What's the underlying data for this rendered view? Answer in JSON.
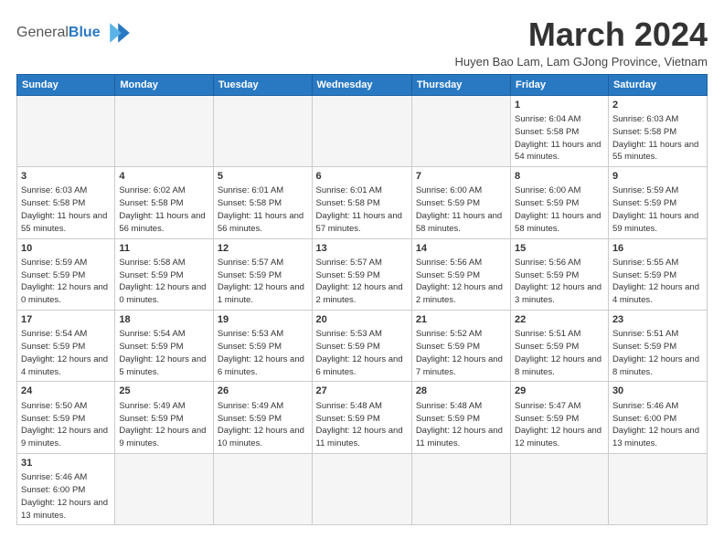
{
  "header": {
    "logo_general": "General",
    "logo_blue": "Blue",
    "month_title": "March 2024",
    "subtitle": "Huyen Bao Lam, Lam GJong Province, Vietnam"
  },
  "weekdays": [
    "Sunday",
    "Monday",
    "Tuesday",
    "Wednesday",
    "Thursday",
    "Friday",
    "Saturday"
  ],
  "weeks": [
    [
      {
        "day": "",
        "info": ""
      },
      {
        "day": "",
        "info": ""
      },
      {
        "day": "",
        "info": ""
      },
      {
        "day": "",
        "info": ""
      },
      {
        "day": "",
        "info": ""
      },
      {
        "day": "1",
        "info": "Sunrise: 6:04 AM\nSunset: 5:58 PM\nDaylight: 11 hours\nand 54 minutes."
      },
      {
        "day": "2",
        "info": "Sunrise: 6:03 AM\nSunset: 5:58 PM\nDaylight: 11 hours\nand 55 minutes."
      }
    ],
    [
      {
        "day": "3",
        "info": "Sunrise: 6:03 AM\nSunset: 5:58 PM\nDaylight: 11 hours\nand 55 minutes."
      },
      {
        "day": "4",
        "info": "Sunrise: 6:02 AM\nSunset: 5:58 PM\nDaylight: 11 hours\nand 56 minutes."
      },
      {
        "day": "5",
        "info": "Sunrise: 6:01 AM\nSunset: 5:58 PM\nDaylight: 11 hours\nand 56 minutes."
      },
      {
        "day": "6",
        "info": "Sunrise: 6:01 AM\nSunset: 5:58 PM\nDaylight: 11 hours\nand 57 minutes."
      },
      {
        "day": "7",
        "info": "Sunrise: 6:00 AM\nSunset: 5:59 PM\nDaylight: 11 hours\nand 58 minutes."
      },
      {
        "day": "8",
        "info": "Sunrise: 6:00 AM\nSunset: 5:59 PM\nDaylight: 11 hours\nand 58 minutes."
      },
      {
        "day": "9",
        "info": "Sunrise: 5:59 AM\nSunset: 5:59 PM\nDaylight: 11 hours\nand 59 minutes."
      }
    ],
    [
      {
        "day": "10",
        "info": "Sunrise: 5:59 AM\nSunset: 5:59 PM\nDaylight: 12 hours\nand 0 minutes."
      },
      {
        "day": "11",
        "info": "Sunrise: 5:58 AM\nSunset: 5:59 PM\nDaylight: 12 hours\nand 0 minutes."
      },
      {
        "day": "12",
        "info": "Sunrise: 5:57 AM\nSunset: 5:59 PM\nDaylight: 12 hours\nand 1 minute."
      },
      {
        "day": "13",
        "info": "Sunrise: 5:57 AM\nSunset: 5:59 PM\nDaylight: 12 hours\nand 2 minutes."
      },
      {
        "day": "14",
        "info": "Sunrise: 5:56 AM\nSunset: 5:59 PM\nDaylight: 12 hours\nand 2 minutes."
      },
      {
        "day": "15",
        "info": "Sunrise: 5:56 AM\nSunset: 5:59 PM\nDaylight: 12 hours\nand 3 minutes."
      },
      {
        "day": "16",
        "info": "Sunrise: 5:55 AM\nSunset: 5:59 PM\nDaylight: 12 hours\nand 4 minutes."
      }
    ],
    [
      {
        "day": "17",
        "info": "Sunrise: 5:54 AM\nSunset: 5:59 PM\nDaylight: 12 hours\nand 4 minutes."
      },
      {
        "day": "18",
        "info": "Sunrise: 5:54 AM\nSunset: 5:59 PM\nDaylight: 12 hours\nand 5 minutes."
      },
      {
        "day": "19",
        "info": "Sunrise: 5:53 AM\nSunset: 5:59 PM\nDaylight: 12 hours\nand 6 minutes."
      },
      {
        "day": "20",
        "info": "Sunrise: 5:53 AM\nSunset: 5:59 PM\nDaylight: 12 hours\nand 6 minutes."
      },
      {
        "day": "21",
        "info": "Sunrise: 5:52 AM\nSunset: 5:59 PM\nDaylight: 12 hours\nand 7 minutes."
      },
      {
        "day": "22",
        "info": "Sunrise: 5:51 AM\nSunset: 5:59 PM\nDaylight: 12 hours\nand 8 minutes."
      },
      {
        "day": "23",
        "info": "Sunrise: 5:51 AM\nSunset: 5:59 PM\nDaylight: 12 hours\nand 8 minutes."
      }
    ],
    [
      {
        "day": "24",
        "info": "Sunrise: 5:50 AM\nSunset: 5:59 PM\nDaylight: 12 hours\nand 9 minutes."
      },
      {
        "day": "25",
        "info": "Sunrise: 5:49 AM\nSunset: 5:59 PM\nDaylight: 12 hours\nand 9 minutes."
      },
      {
        "day": "26",
        "info": "Sunrise: 5:49 AM\nSunset: 5:59 PM\nDaylight: 12 hours\nand 10 minutes."
      },
      {
        "day": "27",
        "info": "Sunrise: 5:48 AM\nSunset: 5:59 PM\nDaylight: 12 hours\nand 11 minutes."
      },
      {
        "day": "28",
        "info": "Sunrise: 5:48 AM\nSunset: 5:59 PM\nDaylight: 12 hours\nand 11 minutes."
      },
      {
        "day": "29",
        "info": "Sunrise: 5:47 AM\nSunset: 5:59 PM\nDaylight: 12 hours\nand 12 minutes."
      },
      {
        "day": "30",
        "info": "Sunrise: 5:46 AM\nSunset: 6:00 PM\nDaylight: 12 hours\nand 13 minutes."
      }
    ],
    [
      {
        "day": "31",
        "info": "Sunrise: 5:46 AM\nSunset: 6:00 PM\nDaylight: 12 hours\nand 13 minutes."
      },
      {
        "day": "",
        "info": ""
      },
      {
        "day": "",
        "info": ""
      },
      {
        "day": "",
        "info": ""
      },
      {
        "day": "",
        "info": ""
      },
      {
        "day": "",
        "info": ""
      },
      {
        "day": "",
        "info": ""
      }
    ]
  ]
}
